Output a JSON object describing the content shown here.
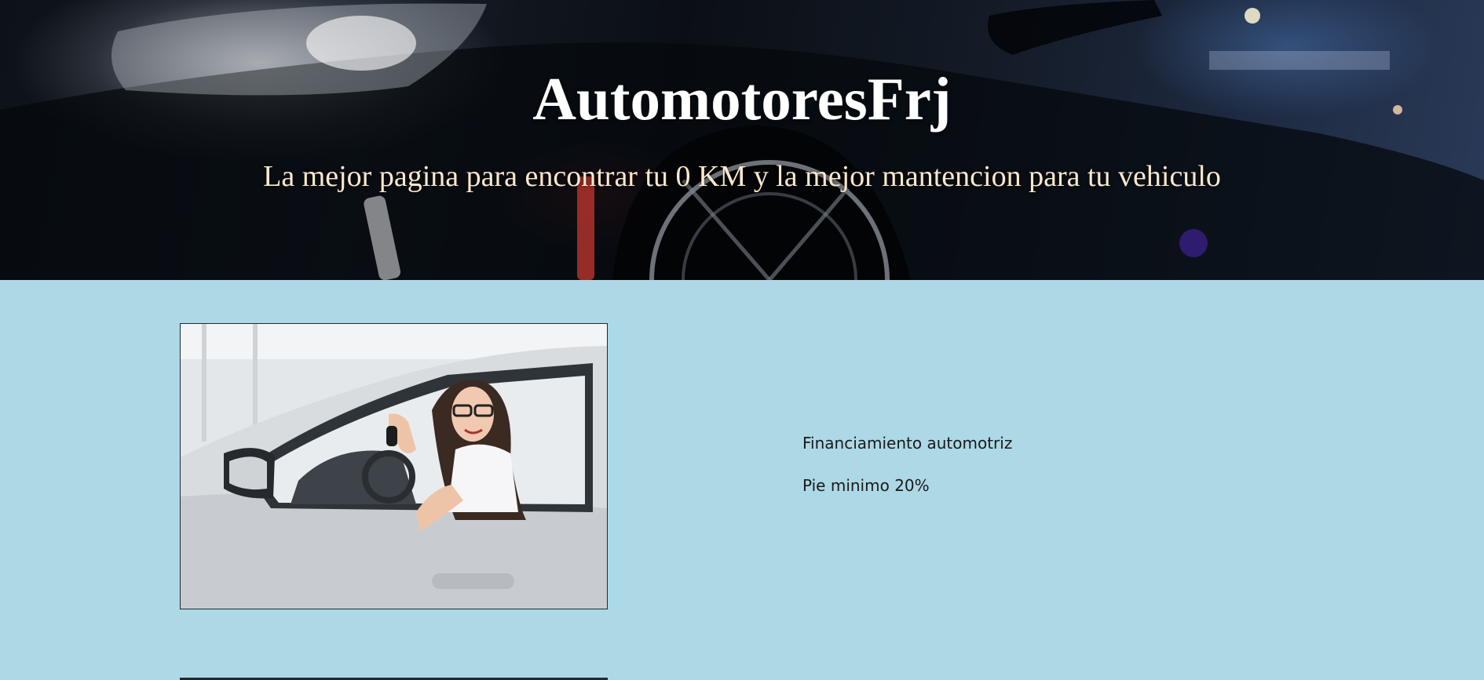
{
  "hero": {
    "title": "AutomotoresFrj",
    "subtitle": "La mejor pagina para encontrar tu 0 KM y la mejor mantencion para tu vehiculo"
  },
  "financing": {
    "image_alt": "woman-in-car-with-keys-photo",
    "line_1": "Financiamiento automotriz",
    "line_2": "Pie minimo 20%"
  },
  "colors": {
    "page_background": "#add8e6",
    "hero_title": "#ffffff",
    "hero_subtitle": "#fbe8cc"
  }
}
